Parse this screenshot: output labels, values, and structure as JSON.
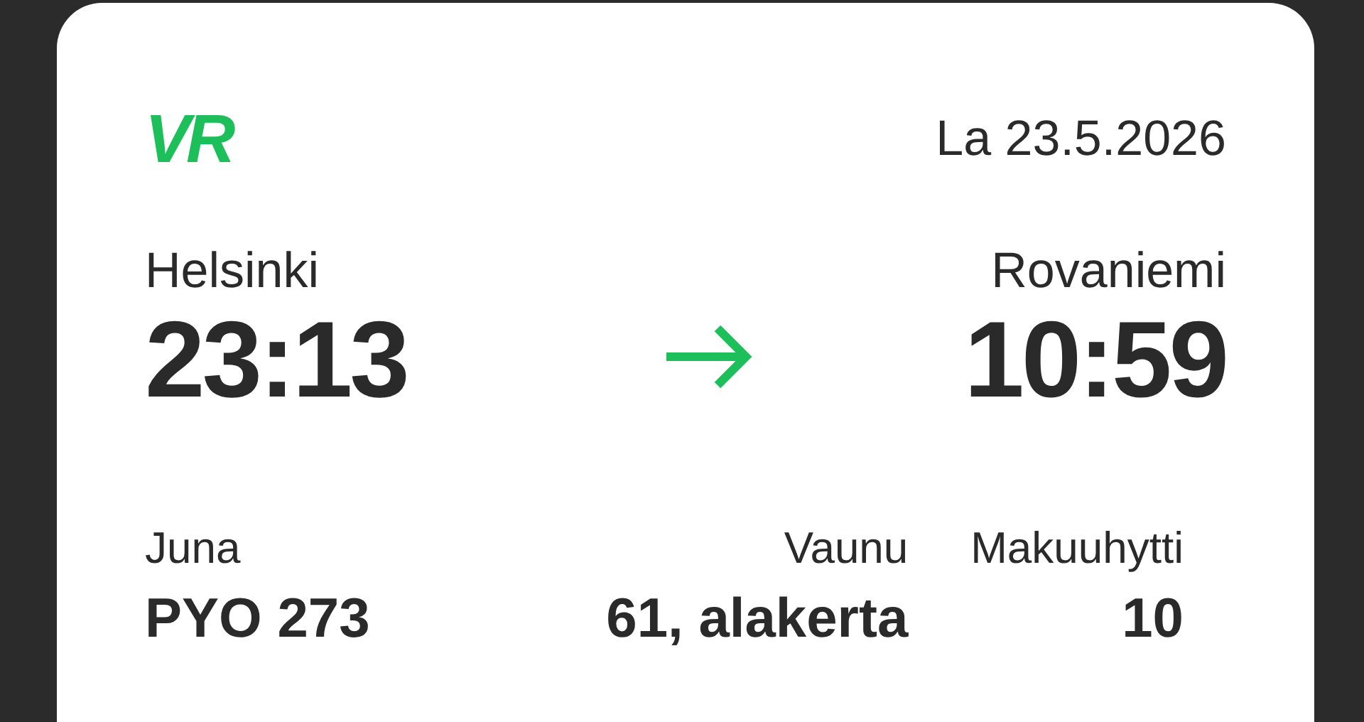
{
  "logo": "VR",
  "date": "La 23.5.2026",
  "departure": {
    "station": "Helsinki",
    "time": "23:13"
  },
  "arrival": {
    "station": "Rovaniemi",
    "time": "10:59"
  },
  "details": [
    {
      "label": "Juna",
      "value": "PYO 273"
    },
    {
      "label": "Vaunu",
      "value": "61, alakerta"
    },
    {
      "label": "Makuuhytti",
      "value": "10"
    }
  ]
}
